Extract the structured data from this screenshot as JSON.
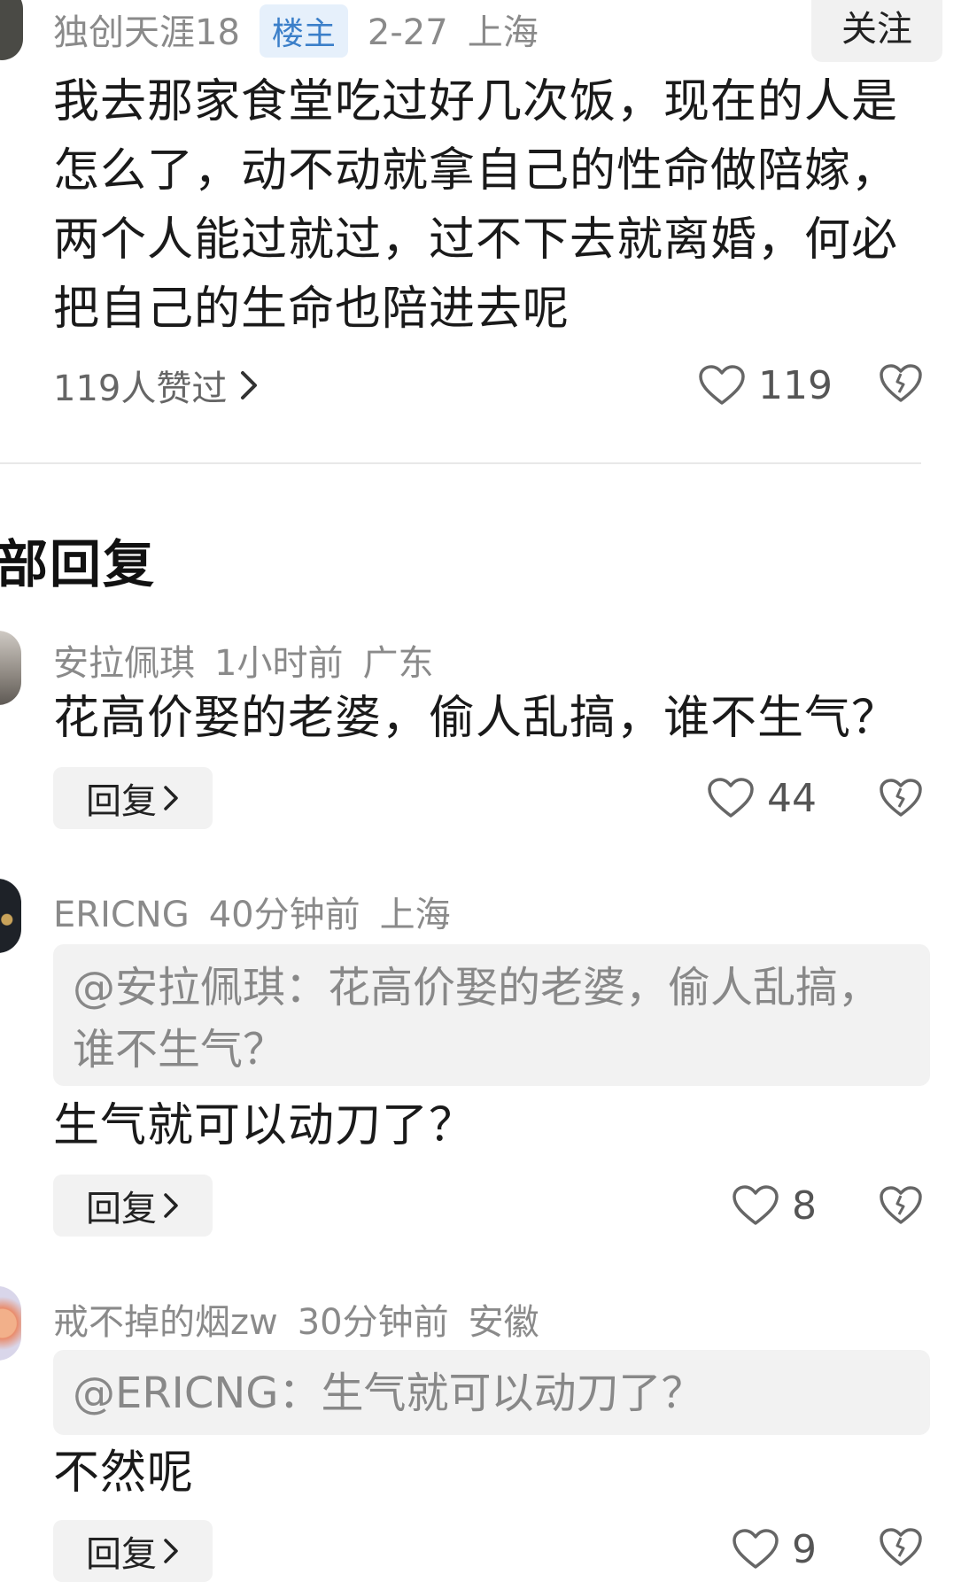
{
  "post": {
    "author": "独创天涯18",
    "badge": "楼主",
    "date": "2-27",
    "location": "上海",
    "follow_label": "关注",
    "text": "我去那家食堂吃过好几次饭，现在的人是怎么了，动不动就拿自己的性命做陪嫁，两个人能过就过，过不下去就离婚，何必把自己的生命也陪进去呢",
    "likes_link": "119人赞过",
    "like_count": "119"
  },
  "section_title": "部回复",
  "replies": [
    {
      "author": "安拉佩琪",
      "time": "1小时前",
      "location": "广东",
      "text": "花高价娶的老婆，偷人乱搞，谁不生气？",
      "reply_label": "回复",
      "like_count": "44"
    },
    {
      "author": "ERICNG",
      "time": "40分钟前",
      "location": "上海",
      "quote": "@安拉佩琪：花高价娶的老婆，偷人乱搞，谁不生气？",
      "text": "生气就可以动刀了？",
      "reply_label": "回复",
      "like_count": "8"
    },
    {
      "author": "戒不掉的烟zw",
      "time": "30分钟前",
      "location": "安徽",
      "quote": "@ERICNG：生气就可以动刀了？",
      "text": "不然呢",
      "reply_label": "回复",
      "like_count": "9"
    }
  ],
  "icons": {
    "like": "heart-outline-icon",
    "dislike": "broken-heart-icon",
    "chevron": "chevron-right-icon"
  }
}
